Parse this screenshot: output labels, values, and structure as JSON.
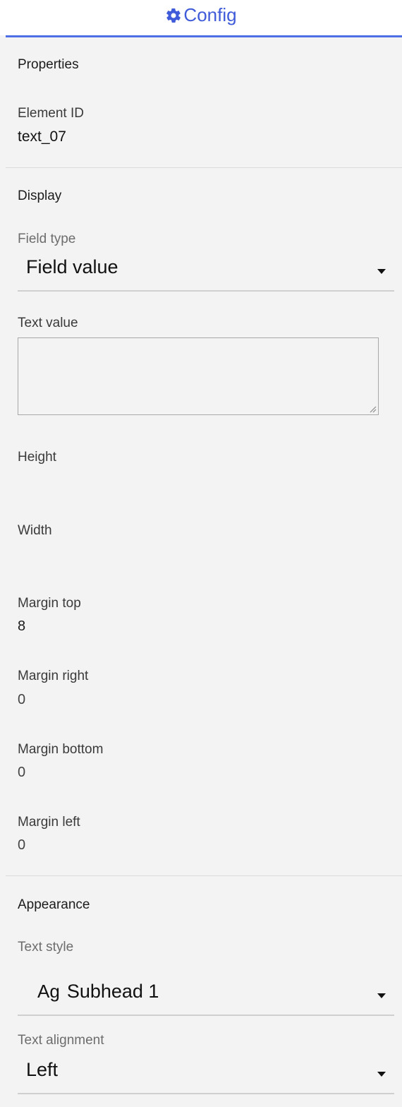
{
  "header": {
    "tab_label": "Config",
    "icon": "gear-icon",
    "accent_color": "#4f6fe6"
  },
  "properties": {
    "title": "Properties",
    "element_id_label": "Element ID",
    "element_id_value": "text_07"
  },
  "display": {
    "title": "Display",
    "field_type_label": "Field type",
    "field_type_value": "Field value",
    "text_value_label": "Text value",
    "text_value": "",
    "height_label": "Height",
    "width_label": "Width",
    "margin_top_label": "Margin top",
    "margin_top_value": "8",
    "margin_right_label": "Margin right",
    "margin_right_value": "0",
    "margin_bottom_label": "Margin bottom",
    "margin_bottom_value": "0",
    "margin_left_label": "Margin left",
    "margin_left_value": "0"
  },
  "appearance": {
    "title": "Appearance",
    "text_style_label": "Text style",
    "text_style_prefix": "Ag",
    "text_style_value": "Subhead 1",
    "text_alignment_label": "Text alignment",
    "text_alignment_value": "Left"
  }
}
